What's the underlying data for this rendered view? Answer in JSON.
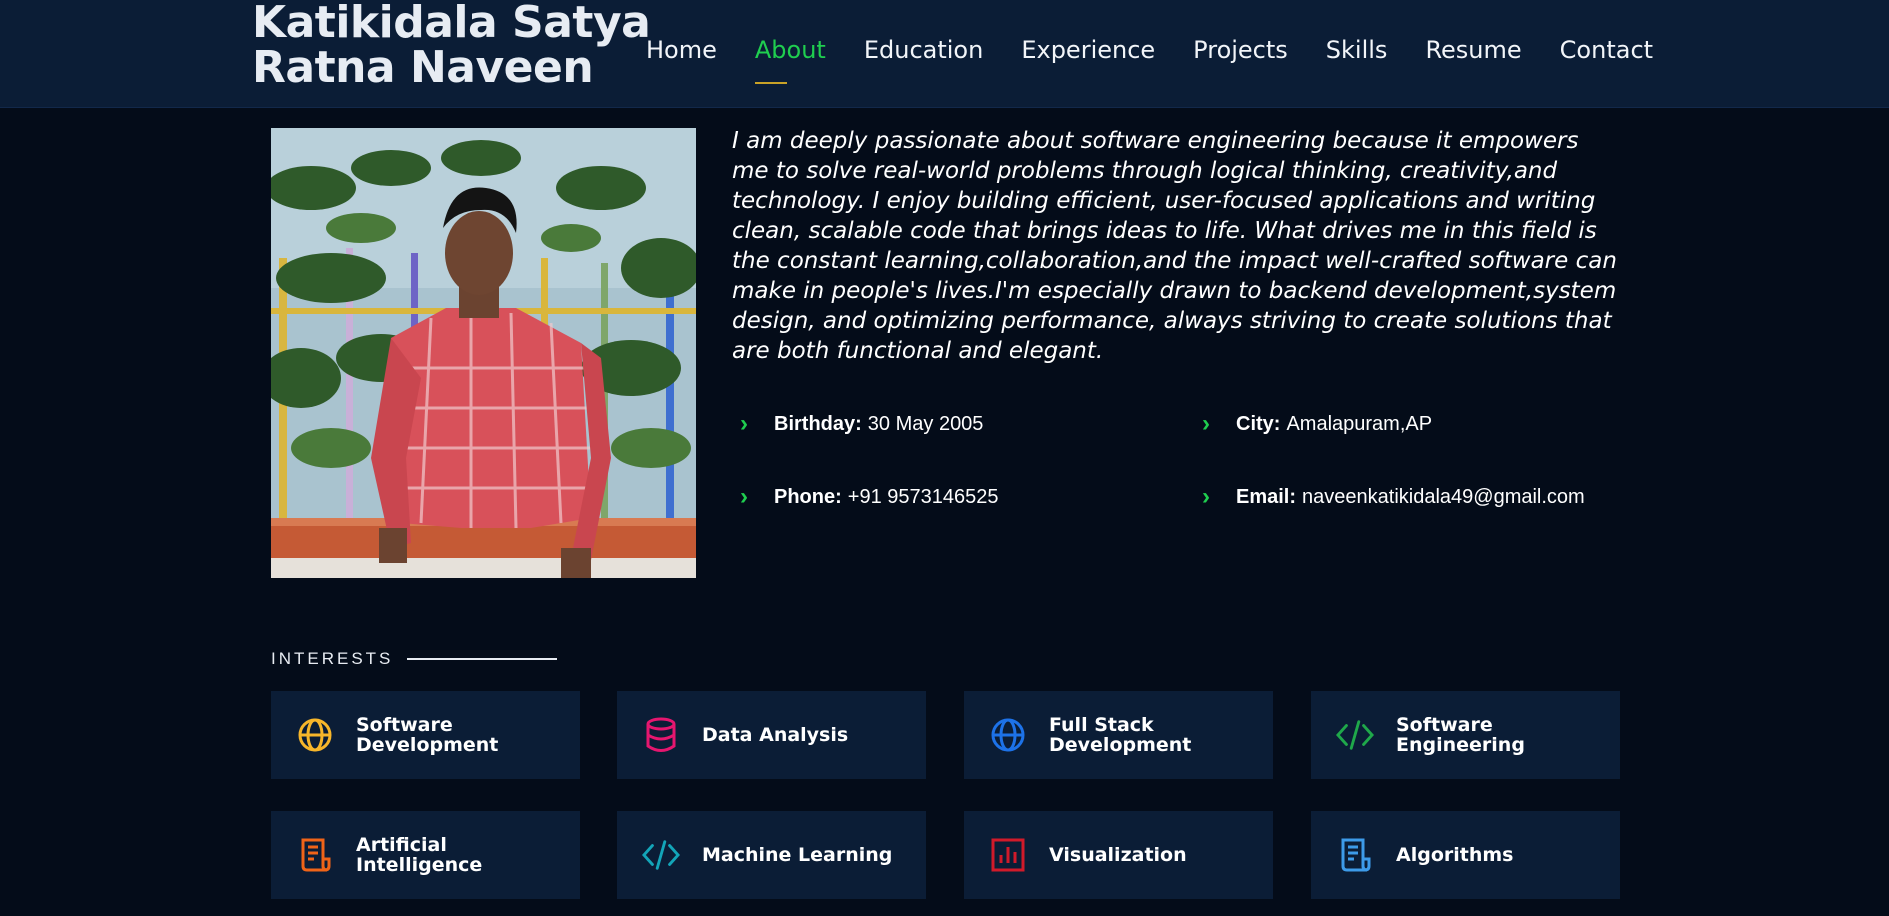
{
  "brand": {
    "name": "Katikidala Satya Ratna Naveen"
  },
  "nav": {
    "items": [
      {
        "label": "Home",
        "active": false
      },
      {
        "label": "About",
        "active": true
      },
      {
        "label": "Education",
        "active": false
      },
      {
        "label": "Experience",
        "active": false
      },
      {
        "label": "Projects",
        "active": false
      },
      {
        "label": "Skills",
        "active": false
      },
      {
        "label": "Resume",
        "active": false
      },
      {
        "label": "Contact",
        "active": false
      }
    ]
  },
  "about": {
    "paragraph": "I am deeply passionate about software engineering because it empowers me to solve real-world problems through logical thinking, creativity,and technology. I enjoy building efficient, user-focused applications and writing clean, scalable code that brings ideas to life. What drives me in this field is the constant learning,collaboration,and the impact well-crafted software can make in people's lives.I'm especially drawn to backend development,system design, and optimizing performance, always striving to create solutions that are both functional and elegant.",
    "birthday_label": "Birthday:",
    "birthday_value": "30 May 2005",
    "city_label": "City:",
    "city_value": "Amalapuram,AP",
    "phone_label": "Phone:",
    "phone_value": "+91 9573146525",
    "email_label": "Email:",
    "email_value": "naveenkatikidala49@gmail.com"
  },
  "interests": {
    "title": "INTERESTS",
    "items": [
      {
        "label": "Software Development",
        "icon": "globe-icon",
        "color": "#f7b62a"
      },
      {
        "label": "Data Analysis",
        "icon": "database-icon",
        "color": "#e5166f"
      },
      {
        "label": "Full Stack Development",
        "icon": "globe-icon",
        "color": "#1d72e8"
      },
      {
        "label": "Software Engineering",
        "icon": "code-icon",
        "color": "#1fa84a"
      },
      {
        "label": "Artificial Intelligence",
        "icon": "document-icon",
        "color": "#f06418"
      },
      {
        "label": "Machine Learning",
        "icon": "code-icon",
        "color": "#13a5b8"
      },
      {
        "label": "Visualization",
        "icon": "bar-chart-icon",
        "color": "#d11a2a"
      },
      {
        "label": "Algorithms",
        "icon": "document-icon",
        "color": "#3d9be9"
      }
    ]
  },
  "colors": {
    "header_bg": "#0b1d36",
    "page_bg": "#040c19",
    "accent": "#1fce4f"
  }
}
